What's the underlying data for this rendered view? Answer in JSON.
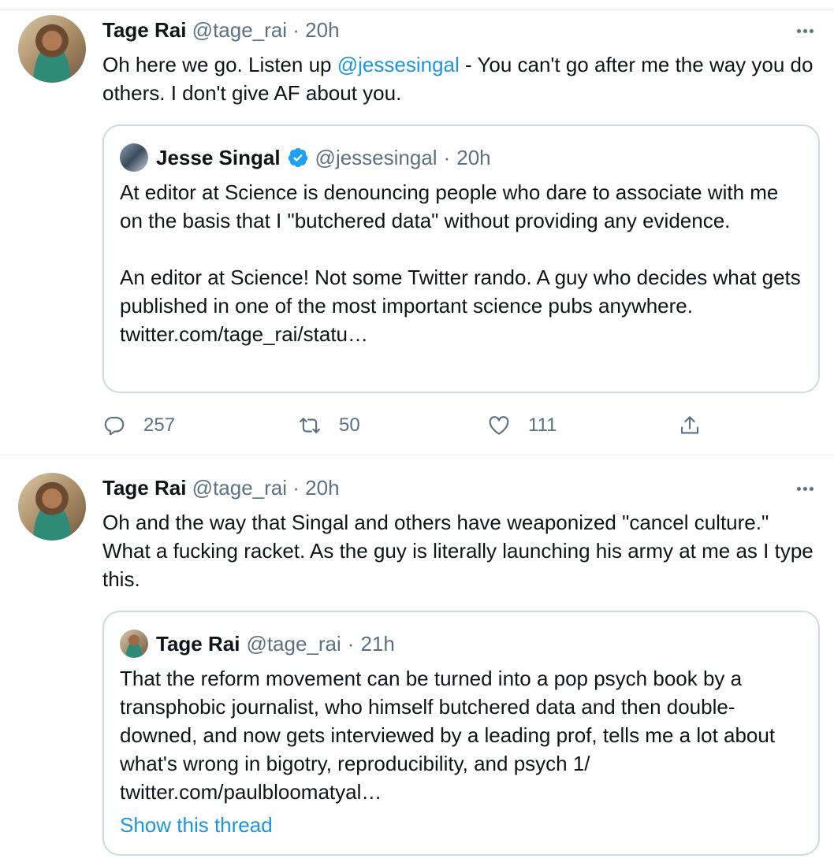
{
  "tweets": [
    {
      "author": {
        "name": "Tage Rai",
        "handle": "@tage_rai",
        "dot": "·",
        "time": "20h"
      },
      "text_parts": {
        "before": "Oh here we go. Listen up ",
        "mention": "@jessesingal",
        "after": " - You can't go after me the way you do others. I don't give AF about you."
      },
      "quote": {
        "author": {
          "name": "Jesse Singal",
          "verified": true,
          "handle": "@jessesingal",
          "dot": "·",
          "time": "20h"
        },
        "paragraphs": [
          "At editor at Science is denouncing people who dare to associate with me on the basis that I \"butchered data\" without providing any evidence.",
          "An editor at Science! Not some Twitter rando. A guy who decides what gets published in one of the most important science pubs anywhere. twitter.com/tage_rai/statu…"
        ]
      },
      "actions": {
        "replies": "257",
        "retweets": "50",
        "likes": "111"
      }
    },
    {
      "author": {
        "name": "Tage Rai",
        "handle": "@tage_rai",
        "dot": "·",
        "time": "20h"
      },
      "text": "Oh and the way that Singal and others have weaponized \"cancel culture.\" What a fucking racket. As the guy is literally launching his army at me as I type this.",
      "quote": {
        "author": {
          "name": "Tage Rai",
          "handle": "@tage_rai",
          "dot": "·",
          "time": "21h"
        },
        "paragraphs": [
          "That the reform movement can be turned into a pop psych book by a transphobic journalist, who himself butchered data and then double-downed, and now gets interviewed by a leading prof, tells me a lot about what's wrong in bigotry, reproducibility, and psych 1/ twitter.com/paulbloomatyal…"
        ],
        "show_thread": "Show this thread"
      }
    }
  ],
  "colors": {
    "link": "#1b95e0",
    "muted": "#5b7083",
    "border": "#cfd9de",
    "verified": "#1da1f2"
  },
  "icons": [
    "more-icon",
    "verified-badge-icon",
    "reply-icon",
    "retweet-icon",
    "like-icon",
    "share-icon"
  ]
}
